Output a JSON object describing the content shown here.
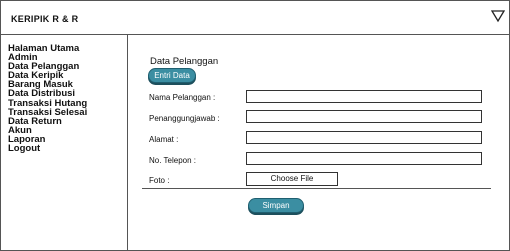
{
  "app": {
    "title": "KERIPIK R & R",
    "menu_icon": "triangle-down-icon"
  },
  "sidebar": {
    "items": [
      {
        "label": "Halaman Utama"
      },
      {
        "label": "Admin"
      },
      {
        "label": "Data Pelanggan"
      },
      {
        "label": "Data Keripik"
      },
      {
        "label": "Barang Masuk"
      },
      {
        "label": "Data Distribusi"
      },
      {
        "label": "Transaksi Hutang"
      },
      {
        "label": "Transaksi Selesai"
      },
      {
        "label": "Data Return"
      },
      {
        "label": "Akun"
      },
      {
        "label": "Laporan"
      },
      {
        "label": "Logout"
      }
    ]
  },
  "form": {
    "section_title": "Data Pelanggan",
    "entry_button": "Entri Data",
    "fields": {
      "nama": {
        "label": "Nama Pelanggan :",
        "value": ""
      },
      "pj": {
        "label": "Penanggungjawab :",
        "value": ""
      },
      "alamat": {
        "label": "Alamat :",
        "value": ""
      },
      "telepon": {
        "label": "No. Telepon :",
        "value": ""
      },
      "foto": {
        "label": "Foto :",
        "button": "Choose File"
      }
    },
    "submit_button": "Simpan"
  },
  "colors": {
    "accent": "#3b8ea2",
    "accent_dark": "#1f5f70",
    "border": "#555555"
  }
}
